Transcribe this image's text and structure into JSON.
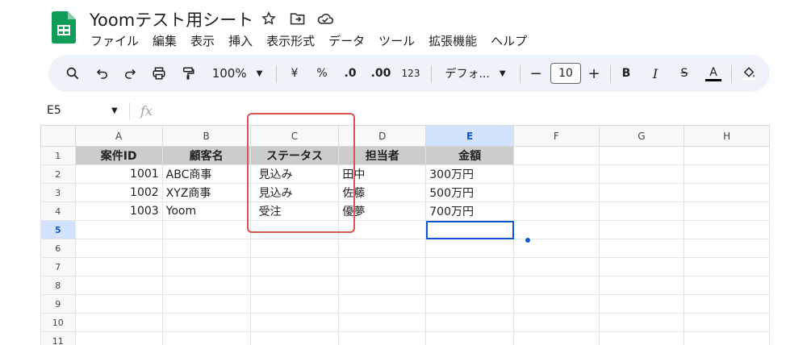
{
  "document": {
    "title": "Yoomテスト用シート"
  },
  "menu": [
    "ファイル",
    "編集",
    "表示",
    "挿入",
    "表示形式",
    "データ",
    "ツール",
    "拡張機能",
    "ヘルプ"
  ],
  "toolbar": {
    "zoom": "100%",
    "currency": "¥",
    "percent": "%",
    "dec_decrease": ".0",
    "dec_increase": ".00",
    "number_format": "123",
    "font": "デフォ...",
    "minus": "−",
    "font_size": "10",
    "plus": "+",
    "bold": "B",
    "italic": "I",
    "strike": "S",
    "text_color": "A"
  },
  "formula_bar": {
    "cell_ref": "E5",
    "fx": "fx"
  },
  "sheet": {
    "columns": [
      "A",
      "B",
      "C",
      "D",
      "E",
      "F",
      "G",
      "H"
    ],
    "row_numbers": [
      "1",
      "2",
      "3",
      "4",
      "5",
      "6",
      "7",
      "8",
      "9",
      "10",
      "11"
    ],
    "header": [
      "案件ID",
      "顧客名",
      "ステータス",
      "担当者",
      "金額"
    ],
    "rows": [
      [
        "1001",
        "ABC商事",
        "見込み",
        "田中",
        "300万円"
      ],
      [
        "1002",
        "XYZ商事",
        "見込み",
        "佐藤",
        "500万円"
      ],
      [
        "1003",
        "Yoom",
        "受注",
        "優夢",
        "700万円"
      ]
    ]
  },
  "colors": {
    "accent": "#0b57d0",
    "header_fill": "#cccccc",
    "highlight_box": "#d9534f",
    "logo": "#0f9d58"
  }
}
